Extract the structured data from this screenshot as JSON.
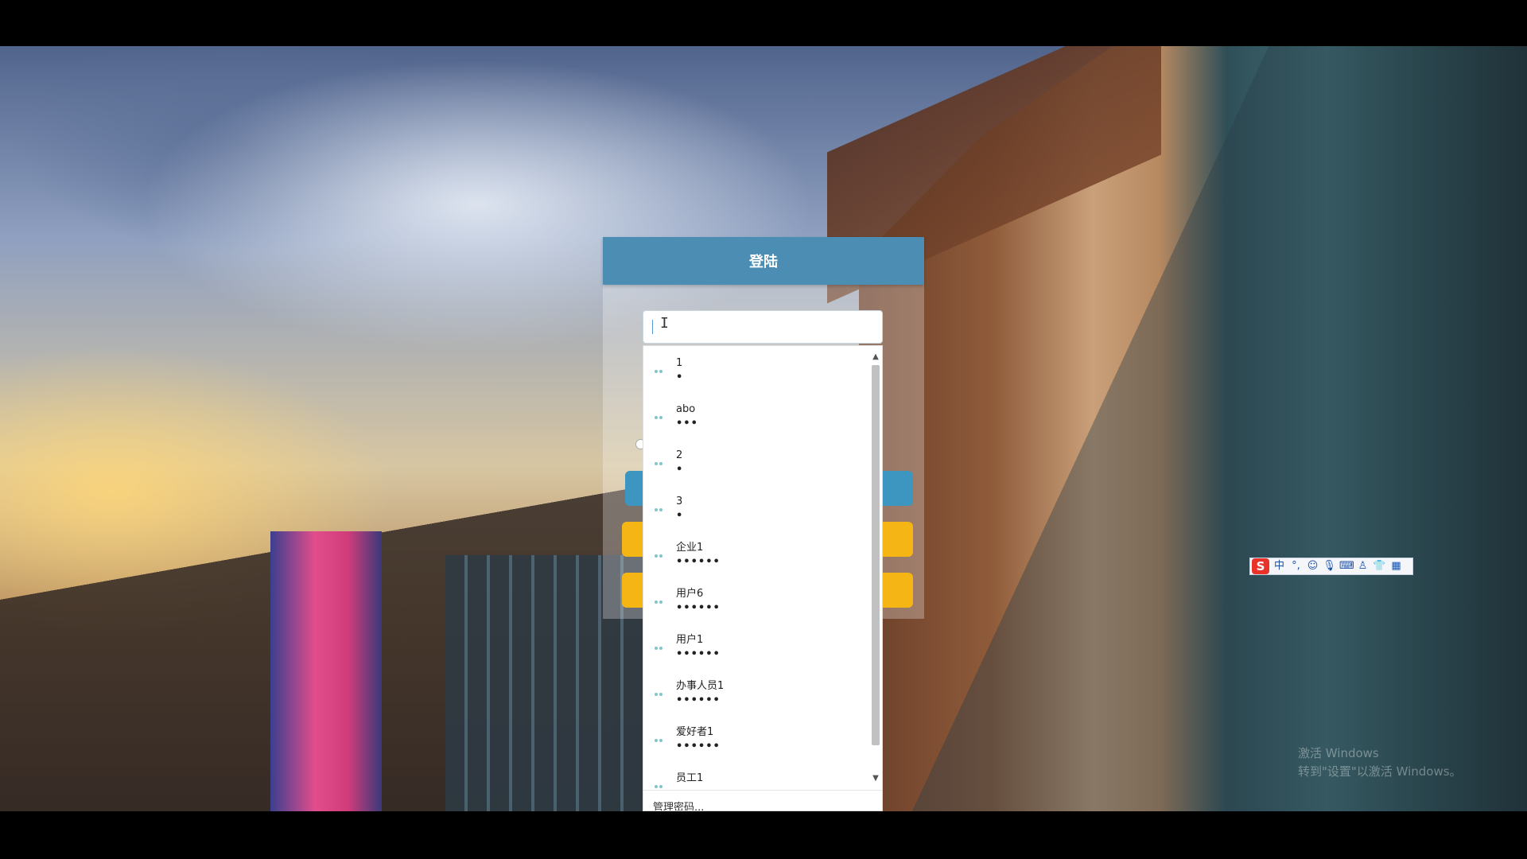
{
  "login": {
    "title": "登陆",
    "username_value": ""
  },
  "autofill": {
    "suggestions": [
      {
        "user": "1",
        "pass": "•"
      },
      {
        "user": "abo",
        "pass": "•••"
      },
      {
        "user": "2",
        "pass": "•"
      },
      {
        "user": "3",
        "pass": "•"
      },
      {
        "user": "企业1",
        "pass": "••••••"
      },
      {
        "user": "用户6",
        "pass": "••••••"
      },
      {
        "user": "用户1",
        "pass": "••••••"
      },
      {
        "user": "办事人员1",
        "pass": "••••••"
      },
      {
        "user": "爱好者1",
        "pass": "••••••"
      },
      {
        "user": "员工1",
        "pass": ""
      }
    ],
    "manage_label": "管理密码..."
  },
  "ime": {
    "logo": "S",
    "mode": "中",
    "items": [
      "°,",
      "☺",
      "🎙",
      "⌨",
      "♙",
      "👕",
      "▦"
    ]
  },
  "watermark": {
    "line1": "激活 Windows",
    "line2": "转到\"设置\"以激活 Windows。"
  },
  "colors": {
    "header": "#4b8db3",
    "login_button": "#3d96c0",
    "secondary_buttons": "#f5b515",
    "key_icon": "#7fc6c9"
  }
}
